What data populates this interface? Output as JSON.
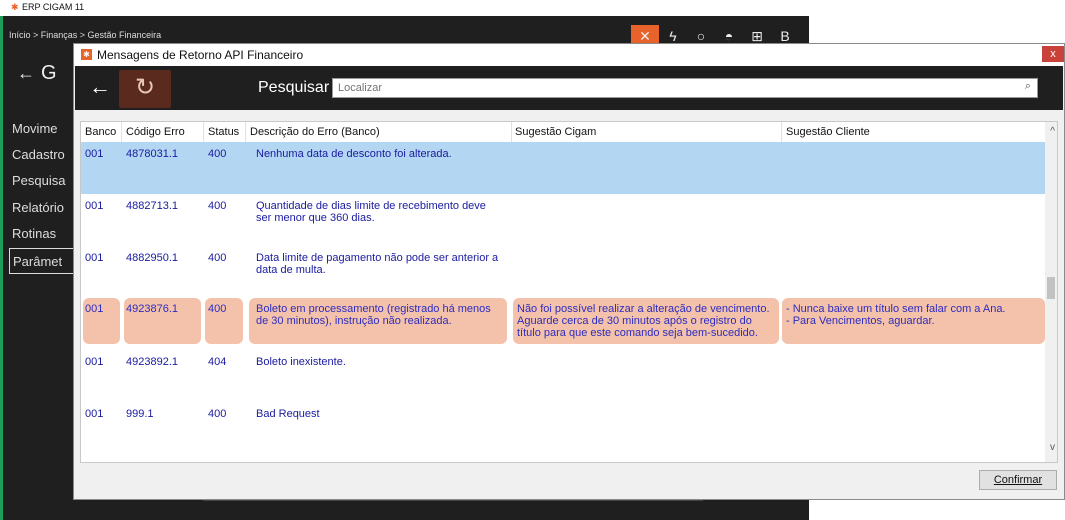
{
  "background_app": {
    "title": "ERP CIGAM 11",
    "breadcrumb": "Início > Finanças > Gestão Financeira",
    "page_title_initial": "G",
    "menu": [
      "Movime",
      "Cadastro",
      "Pesquisa",
      "Relatório",
      "Rotinas",
      "Parâmet"
    ],
    "top_icons": [
      "tools-icon",
      "lightning-icon",
      "circle-icon",
      "tower-icon",
      "grid-icon",
      "B"
    ],
    "accent_color": "#e8632b"
  },
  "dialog": {
    "title": "Mensagens de Retorno API Financeiro",
    "close_label": "x",
    "toolbar": {
      "back_icon": "arrow-left-icon",
      "refresh_icon": "refresh-icon",
      "search_label": "Pesquisar",
      "search_placeholder": "Localizar",
      "search_icon": "search-icon"
    },
    "grid": {
      "columns": [
        "Banco",
        "Código Erro",
        "Status",
        "Descrição do Erro (Banco)",
        "Sugestão Cigam",
        "Sugestão Cliente"
      ],
      "rows": [
        {
          "banco": "001",
          "codigo": "4878031.1",
          "status": "400",
          "descricao": "Nenhuma data de desconto foi alterada.",
          "sug_cigam": "",
          "sug_cliente": "",
          "state": "selected"
        },
        {
          "banco": "001",
          "codigo": "4882713.1",
          "status": "400",
          "descricao": "Quantidade de dias limite de recebimento deve ser menor que 360 dias.",
          "sug_cigam": "",
          "sug_cliente": "",
          "state": "normal"
        },
        {
          "banco": "001",
          "codigo": "4882950.1",
          "status": "400",
          "descricao": "Data limite de pagamento não pode ser anterior a data de multa.",
          "sug_cigam": "",
          "sug_cliente": "",
          "state": "normal"
        },
        {
          "banco": "001",
          "codigo": "4923876.1",
          "status": "400",
          "descricao": "Boleto em processamento (registrado há menos de 30 minutos), instrução não realizada.",
          "sug_cigam": "Não foi possível realizar a alteração de vencimento. Aguarde cerca de 30 minutos após o registro do título para que este comando seja bem-sucedido.",
          "sug_cliente": "- Nunca baixe um título sem falar com a Ana.\n- Para Vencimentos, aguardar.",
          "state": "highlighted"
        },
        {
          "banco": "001",
          "codigo": "4923892.1",
          "status": "404",
          "descricao": "Boleto inexistente.",
          "sug_cigam": "",
          "sug_cliente": "",
          "state": "normal"
        },
        {
          "banco": "001",
          "codigo": "999.1",
          "status": "400",
          "descricao": "Bad Request",
          "sug_cigam": "",
          "sug_cliente": "",
          "state": "normal"
        }
      ]
    },
    "confirm_label": "Confirmar"
  }
}
